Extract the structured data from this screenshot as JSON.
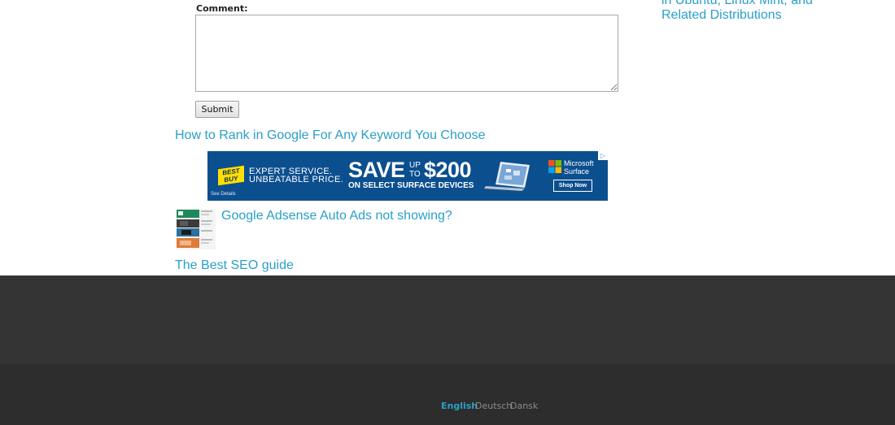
{
  "sidebar": {
    "related_link": "in Ubuntu, Linux Mint, and Related Distributions"
  },
  "comment_form": {
    "label": "Comment:",
    "value": "",
    "submit_label": "Submit"
  },
  "related_posts": [
    {
      "title": "How to Rank in Google For Any Keyword You Choose"
    },
    {
      "title": "Google Adsense Auto Ads not showing?"
    },
    {
      "title": "The Best SEO guide"
    }
  ],
  "ad": {
    "brand": "BEST BUY",
    "line1": "EXPERT SERVICE.",
    "line2": "UNBEATABLE PRICE.",
    "headline_save": "SAVE",
    "headline_upto": "UP TO",
    "headline_amount": "$200",
    "subline": "ON SELECT SURFACE DEVICES",
    "partner": "Microsoft Surface",
    "cta": "Shop Now",
    "details": "See Details",
    "colors": {
      "background": "#0c4f8f",
      "logo": "#ffe000"
    }
  },
  "footer": {
    "languages": [
      {
        "label": "English",
        "active": true
      },
      {
        "label": "Deutsch",
        "active": false
      },
      {
        "label": "Dansk",
        "active": false
      }
    ],
    "colors": {
      "top": "#333333",
      "bottom": "#2d2d2d",
      "link": "#2a9fc9"
    }
  }
}
